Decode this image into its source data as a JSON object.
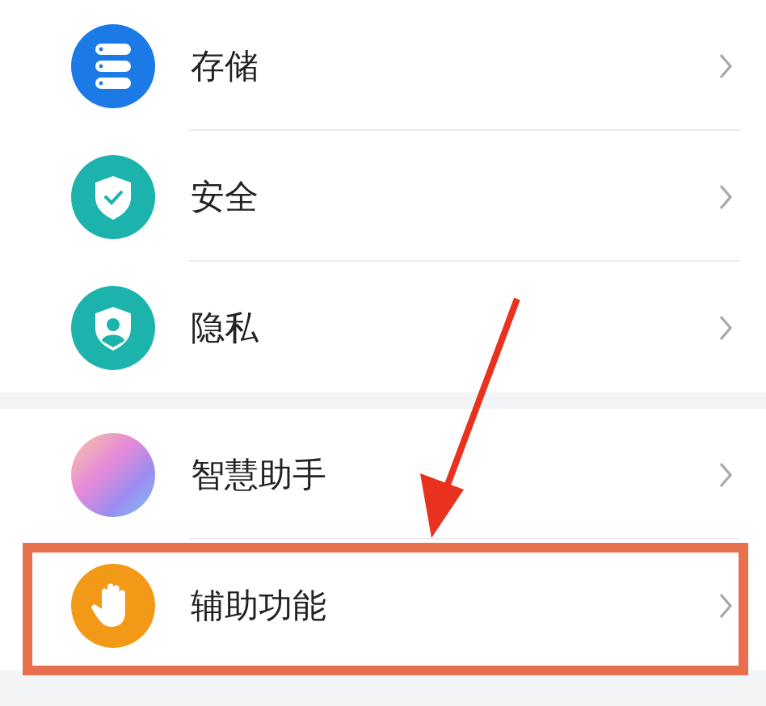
{
  "groups": [
    {
      "items": [
        {
          "label": "存储",
          "kind": "storage",
          "highlighted": false
        },
        {
          "label": "安全",
          "kind": "security",
          "highlighted": false
        },
        {
          "label": "隐私",
          "kind": "privacy",
          "highlighted": false
        }
      ]
    },
    {
      "items": [
        {
          "label": "智慧助手",
          "kind": "assistant",
          "highlighted": false
        },
        {
          "label": "辅助功能",
          "kind": "accessibility",
          "highlighted": true
        }
      ]
    }
  ],
  "annotation": {
    "kind": "arrow"
  }
}
